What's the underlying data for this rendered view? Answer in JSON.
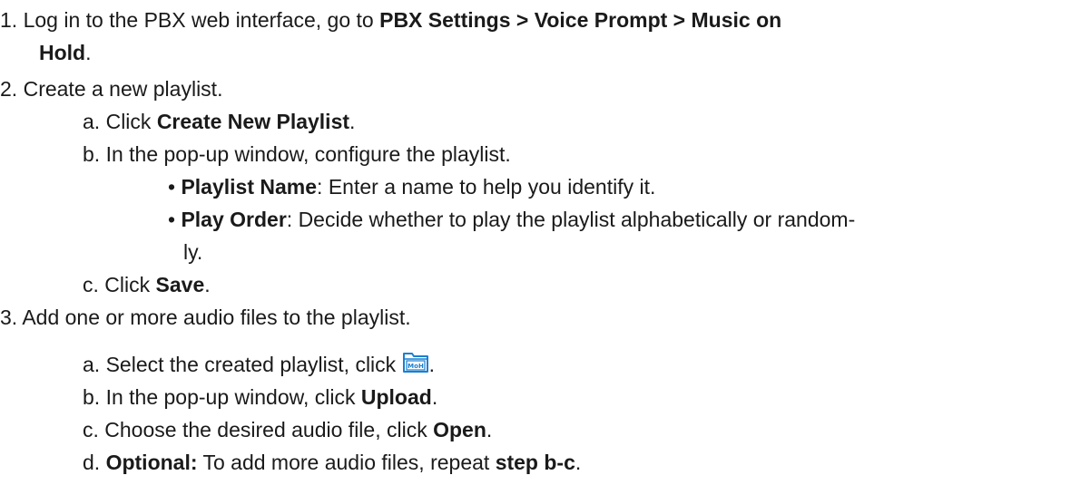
{
  "steps": {
    "s1": {
      "num": "1.",
      "t1": "Log in to the PBX web interface, go to ",
      "b1": "PBX Settings > Voice Prompt > Music on",
      "b2": "Hold",
      "t2": "."
    },
    "s2": {
      "num": "2.",
      "t1": "Create a new playlist.",
      "a": {
        "letter": "a.",
        "t1": "Click ",
        "b1": "Create New Playlist",
        "t2": "."
      },
      "b": {
        "letter": "b.",
        "t1": "In the pop-up window, configure the playlist.",
        "bullets": [
          {
            "mark": "•",
            "b1": "Playlist Name",
            "t1": ": Enter a name to help you identify it."
          },
          {
            "mark": "•",
            "b1": "Play Order",
            "t1": ": Decide whether to play the playlist alphabetically or random-",
            "t2": "ly."
          }
        ]
      },
      "c": {
        "letter": "c.",
        "t1": "Click ",
        "b1": "Save",
        "t2": "."
      }
    },
    "s3": {
      "num": "3.",
      "t1": "Add one or more audio files to the playlist.",
      "a": {
        "letter": "a.",
        "t1": "Select the created playlist, click ",
        "icon_name": "moh-playlist-icon",
        "icon_label": "MoH",
        "t2": "."
      },
      "b": {
        "letter": "b.",
        "t1": "In the pop-up window, click ",
        "b1": "Upload",
        "t2": "."
      },
      "c": {
        "letter": "c.",
        "t1": "Choose the desired audio file, click ",
        "b1": "Open",
        "t2": "."
      },
      "d": {
        "letter": "d.",
        "b1": "Optional:",
        "t1": " To add more audio files, repeat ",
        "b2": "step b-c",
        "t2": "."
      }
    }
  },
  "colors": {
    "text": "#1a1a1a",
    "icon_blue": "#1a7fd1"
  }
}
